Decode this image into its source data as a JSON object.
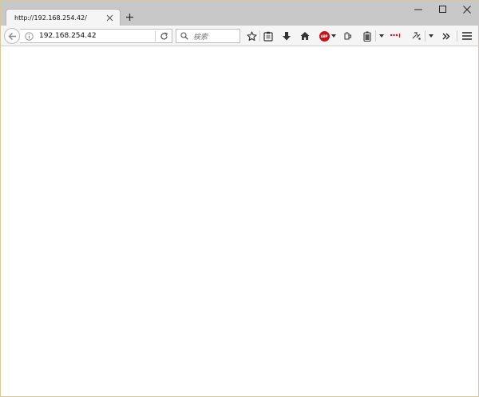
{
  "tab": {
    "title": "http://192.168.254.42/"
  },
  "urlbar": {
    "url": "192.168.254.42"
  },
  "searchbar": {
    "placeholder": "検索"
  },
  "toolbar": {
    "icons": [
      "bookmark-star-icon",
      "reader-clipboard-icon",
      "download-icon",
      "home-icon",
      "adblock-icon",
      "extension-icon",
      "battery-icon",
      "dots-extension-icon",
      "tools-extension-icon",
      "overflow-chevron-icon",
      "hamburger-menu-icon"
    ],
    "adblock_label": "ABP"
  },
  "colors": {
    "tab_strip": "#c8c8c8",
    "toolbar": "#f5f5f5",
    "adblock": "#c7111a"
  }
}
